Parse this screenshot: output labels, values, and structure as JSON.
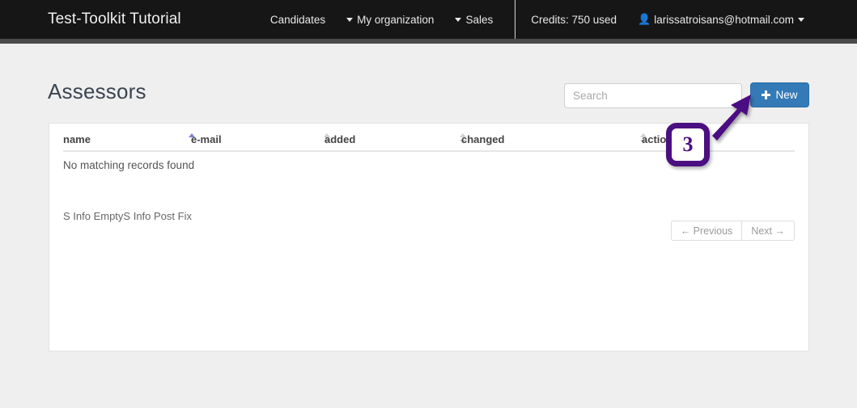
{
  "navbar": {
    "brand": "Test-Toolkit Tutorial",
    "links": [
      {
        "label": "Candidates",
        "caret": "none"
      },
      {
        "label": "My organization",
        "caret": "left"
      },
      {
        "label": "Sales",
        "caret": "left"
      }
    ],
    "credits": "Credits: 750 used",
    "user": "larissatroisans@hotmail.com"
  },
  "page": {
    "title": "Assessors"
  },
  "search": {
    "placeholder": "Search",
    "value": ""
  },
  "toolbar": {
    "new_label": "New"
  },
  "table": {
    "columns": [
      {
        "label": "name",
        "sort": "asc"
      },
      {
        "label": "e-mail",
        "sort": "none"
      },
      {
        "label": "added",
        "sort": "none"
      },
      {
        "label": "changed",
        "sort": "none"
      },
      {
        "label": "actions",
        "sort": "none"
      }
    ],
    "empty_message": "No matching records found",
    "rows": []
  },
  "footer": {
    "info": "S Info EmptyS Info Post Fix",
    "previous_label": "← Previous",
    "next_label": "Next →"
  },
  "annotation": {
    "step_number": "3",
    "color": "#4b0f82"
  },
  "colors": {
    "navbar_bg": "#161616",
    "navbar_strip": "#4a4a4a",
    "page_bg": "#efefef",
    "primary_button": "#337ab7",
    "sort_active": "#7b82d8",
    "annotation_purple": "#4b0f82"
  }
}
